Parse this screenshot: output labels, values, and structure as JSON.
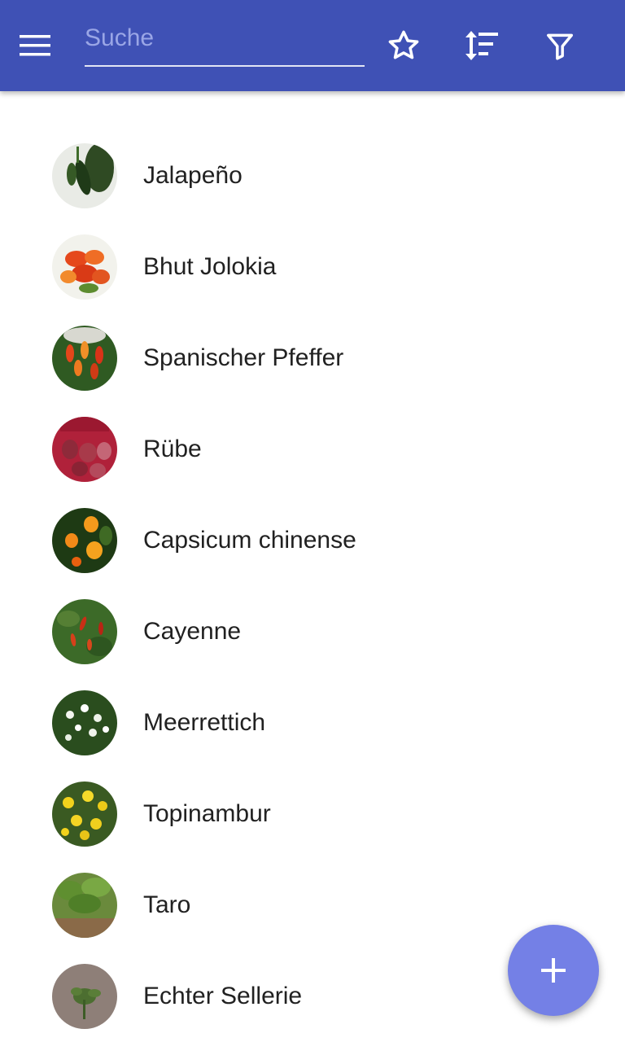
{
  "app_bar": {
    "background": "#3f51b5",
    "menu_icon": "menu-icon",
    "search": {
      "placeholder": "Suche",
      "value": ""
    },
    "actions": [
      {
        "icon": "star-outline-icon"
      },
      {
        "icon": "sort-icon"
      },
      {
        "icon": "filter-icon"
      }
    ]
  },
  "plants": [
    {
      "name": "Jalapeño",
      "thumbnail": "jalapeno-photo"
    },
    {
      "name": "Bhut Jolokia",
      "thumbnail": "bhut-jolokia-photo"
    },
    {
      "name": "Spanischer Pfeffer",
      "thumbnail": "spanischer-pfeffer-photo"
    },
    {
      "name": "Rübe",
      "thumbnail": "ruebe-photo"
    },
    {
      "name": "Capsicum chinense",
      "thumbnail": "capsicum-chinense-photo"
    },
    {
      "name": "Cayenne",
      "thumbnail": "cayenne-photo"
    },
    {
      "name": "Meerrettich",
      "thumbnail": "meerrettich-photo"
    },
    {
      "name": "Topinambur",
      "thumbnail": "topinambur-photo"
    },
    {
      "name": "Taro",
      "thumbnail": "taro-photo"
    },
    {
      "name": "Echter Sellerie",
      "thumbnail": "echter-sellerie-photo"
    }
  ],
  "fab": {
    "icon": "plus-icon",
    "color": "#7480e6"
  }
}
